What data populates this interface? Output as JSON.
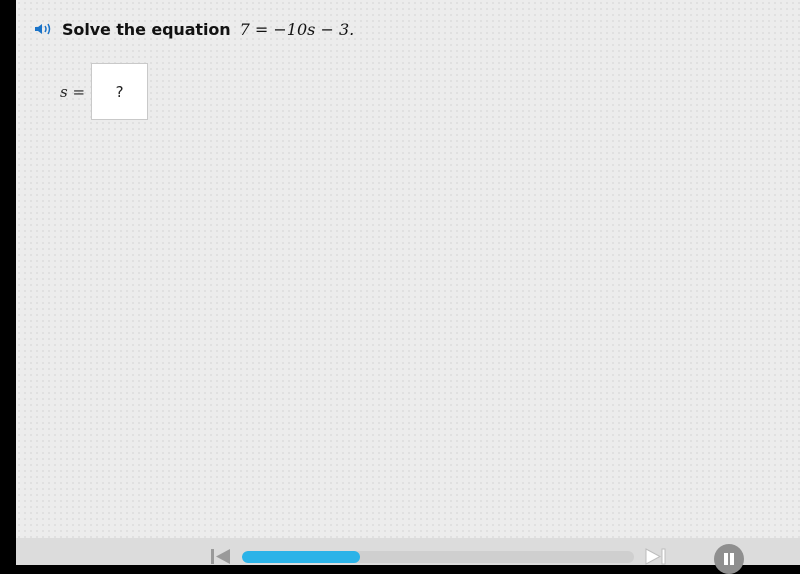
{
  "question": {
    "speaker_icon": "speaker-icon",
    "prompt": "Solve the equation",
    "equation": "7 = −10s − 3."
  },
  "answer": {
    "variable_label": "s =",
    "placeholder": "?"
  },
  "player": {
    "prev_icon": "skip-back-icon",
    "next_icon": "skip-forward-icon",
    "pause_icon": "pause-icon",
    "progress": 0.3,
    "accent_color": "#2bb3e8"
  }
}
